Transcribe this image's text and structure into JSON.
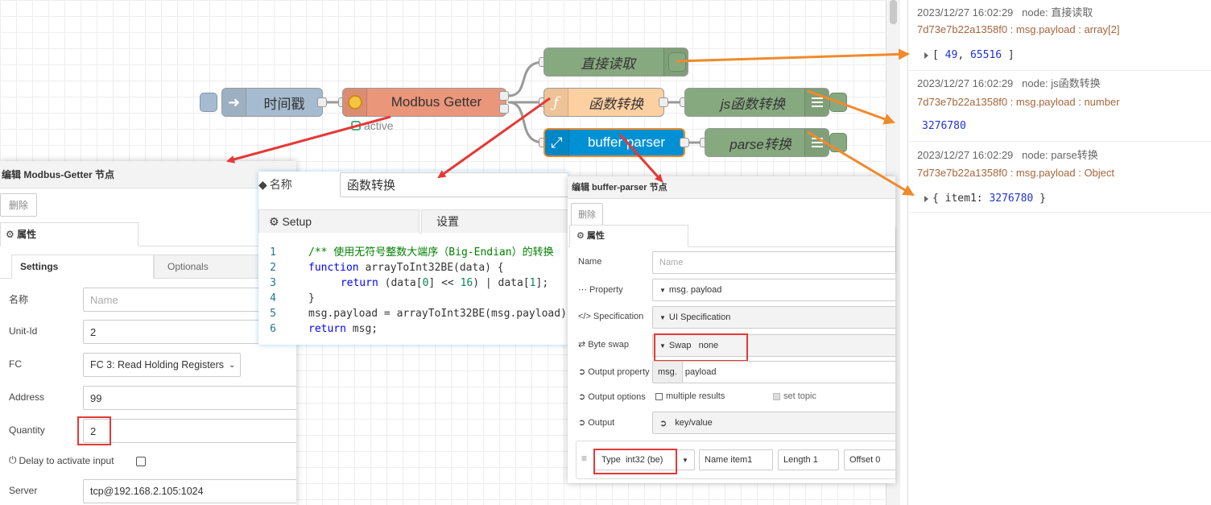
{
  "flow": {
    "inject_label": "时间戳",
    "modbus_label": "Modbus Getter",
    "modbus_status": "active",
    "debug1_label": "直接读取",
    "function_label": "函数转换",
    "debug2_label": "js函数转换",
    "buffer_label": "buffer parser",
    "debug3_label": "parse转换"
  },
  "modbus_panel": {
    "title": "编辑 Modbus-Getter 节点",
    "delete": "删除",
    "props_tab": "属性",
    "tab_settings": "Settings",
    "tab_optionals": "Optionals",
    "name_label": "名称",
    "name_placeholder": "Name",
    "unitid_label": "Unit-Id",
    "unitid_value": "2",
    "fc_label": "FC",
    "fc_value": "FC 3: Read Holding Registers",
    "address_label": "Address",
    "address_value": "99",
    "quantity_label": "Quantity",
    "quantity_value": "2",
    "delay_label": "Delay to activate input",
    "server_label": "Server",
    "server_value": "tcp@192.168.2.105:1024"
  },
  "function_panel": {
    "name_label": "名称",
    "name_value": "函数转换",
    "tab_setup": "Setup",
    "tab_settings": "设置",
    "code": [
      {
        "n": "1",
        "t": "/** 使用无符号整数大端序（Big-Endian）的转换"
      },
      {
        "n": "2",
        "t": "function arrayToInt32BE(data) {"
      },
      {
        "n": "3",
        "t": "    return (data[0] << 16) | data[1];"
      },
      {
        "n": "4",
        "t": "}"
      },
      {
        "n": "5",
        "t": "msg.payload = arrayToInt32BE(msg.payload)"
      },
      {
        "n": "6",
        "t": "return msg;"
      }
    ]
  },
  "buffer_panel": {
    "title": "编辑 buffer-parser 节点",
    "delete": "删除",
    "props_tab": "属性",
    "name_label": "Name",
    "name_placeholder": "Name",
    "property_label": "Property",
    "property_type": "msg.",
    "property_value": "payload",
    "spec_label": "Specification",
    "spec_value": "UI Specification",
    "byteswap_label": "Byte swap",
    "byteswap_type": "Swap",
    "byteswap_value": "none",
    "outprop_label": "Output property",
    "outprop_type": "msg.",
    "outprop_value": "payload",
    "outopts_label": "Output options",
    "multiple_results": "multiple results",
    "set_topic": "set topic",
    "output_label": "Output",
    "output_value": "key/value",
    "item_type_label": "Type",
    "item_type_value": "int32 (be)",
    "item_name_label": "Name",
    "item_name_value": "item1",
    "item_length_label": "Length",
    "item_length_value": "1",
    "item_offset_label": "Offset",
    "item_offset_value": "0"
  },
  "debug": {
    "messages": [
      {
        "time": "2023/12/27 16:02:29",
        "node": "node: 直接读取",
        "topic": "7d73e7b22a1358f0 : msg.payload : array[2]",
        "value_prefix": "[ ",
        "v1": "49",
        "sep": ", ",
        "v2": "65516",
        "value_suffix": " ]"
      },
      {
        "time": "2023/12/27 16:02:29",
        "node": "node: js函数转换",
        "topic": "7d73e7b22a1358f0 : msg.payload : number",
        "value": "3276780"
      },
      {
        "time": "2023/12/27 16:02:29",
        "node": "node: parse转换",
        "topic": "7d73e7b22a1358f0 : msg.payload : Object",
        "value_prefix": "{ item1: ",
        "v1": "3276780",
        "value_suffix": " }"
      }
    ]
  },
  "colors": {
    "modbus": "#e9967a",
    "inject": "#a6bbcf",
    "debug": "#87a980",
    "function": "#fdd0a2",
    "buffer": "#0090d4",
    "arrow_red": "#e53935",
    "arrow_orange": "#f08a2b"
  }
}
